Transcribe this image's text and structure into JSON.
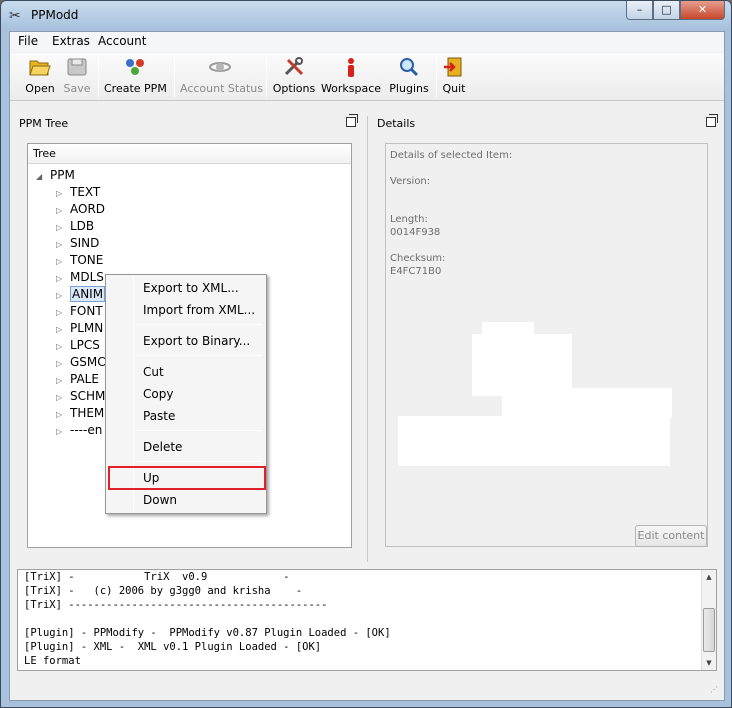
{
  "window": {
    "title": "PPModd",
    "controls": {
      "minimize": "–",
      "maximize": "□",
      "close": "✕"
    }
  },
  "menubar": {
    "items": [
      "File",
      "Extras",
      "Account"
    ]
  },
  "toolbar": {
    "buttons": [
      {
        "label": "Open",
        "icon": "folder-open-icon",
        "enabled": true
      },
      {
        "label": "Save",
        "icon": "disk-icon",
        "enabled": false
      },
      {
        "label": "Create PPM",
        "icon": "create-icon",
        "enabled": true
      },
      {
        "label": "Account Status",
        "icon": "satellite-icon",
        "enabled": false
      },
      {
        "label": "Options",
        "icon": "tools-icon",
        "enabled": true
      },
      {
        "label": "Workspace",
        "icon": "workspace-icon",
        "enabled": true
      },
      {
        "label": "Plugins",
        "icon": "magnifier-icon",
        "enabled": true
      },
      {
        "label": "Quit",
        "icon": "exit-icon",
        "enabled": true
      }
    ]
  },
  "tree_panel": {
    "title": "PPM Tree",
    "header": "Tree",
    "root": "PPM",
    "items": [
      "TEXT",
      "AORD",
      "LDB",
      "SIND",
      "TONE",
      "MDLS",
      "ANIM",
      "FONT",
      "PLMN",
      "LPCS",
      "GSMC",
      "PALE",
      "SCHM",
      "THEM",
      "----en"
    ],
    "selected": "ANIM"
  },
  "details_panel": {
    "title": "Details",
    "heading": "Details of selected Item:",
    "version_label": "Version:",
    "length_label": "Length:",
    "length_value": "0014F938",
    "checksum_label": "Checksum:",
    "checksum_value": "E4FC71B0",
    "edit_button": "Edit content"
  },
  "context_menu": {
    "items": [
      "Export to XML...",
      "Import from XML...",
      "Export to Binary...",
      "Cut",
      "Copy",
      "Paste",
      "Delete",
      "Up",
      "Down"
    ],
    "highlighted": "Up"
  },
  "log": {
    "lines": [
      "[TriX] -           TriX  v0.9            -",
      "[TriX] -   (c) 2006 by g3gg0 and krisha    -",
      "[TriX] -----------------------------------------",
      "",
      "[Plugin] - PPModify -  PPModify v0.87 Plugin Loaded - [OK]",
      "[Plugin] - XML -  XML v0.1 Plugin Loaded - [OK]",
      "LE format"
    ]
  },
  "colors": {
    "highlight_outline": "#e0202a",
    "selection": "#dbe8f8"
  }
}
